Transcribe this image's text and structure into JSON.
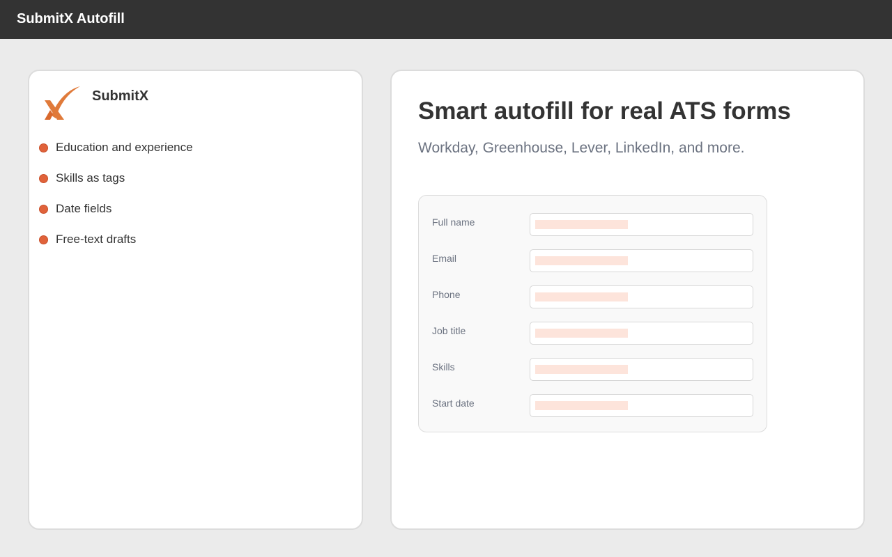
{
  "app": {
    "title": "SubmitX Autofill"
  },
  "brand": {
    "name": "SubmitX",
    "logo_icon": "submitx-x-logo-icon",
    "accent_color": "#e0623a"
  },
  "features": [
    {
      "label": "Education and experience"
    },
    {
      "label": "Skills as tags"
    },
    {
      "label": "Date fields"
    },
    {
      "label": "Free-text drafts"
    }
  ],
  "hero": {
    "title": "Smart autofill for real ATS forms",
    "subtitle": "Workday, Greenhouse, Lever, LinkedIn, and more."
  },
  "form_preview": {
    "fields": [
      {
        "label": "Full name"
      },
      {
        "label": "Email"
      },
      {
        "label": "Phone"
      },
      {
        "label": "Job title"
      },
      {
        "label": "Skills"
      },
      {
        "label": "Start date"
      }
    ]
  }
}
